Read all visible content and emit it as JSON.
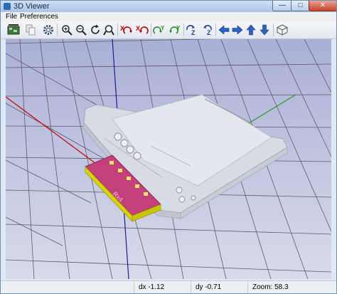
{
  "window": {
    "title": "3D Viewer"
  },
  "menu": {
    "items": [
      "File",
      "Preferences"
    ]
  },
  "toolbar": {
    "buttons": [
      {
        "name": "reload-board-icon"
      },
      {
        "name": "copy-image-icon"
      },
      {
        "name": "settings-icon"
      },
      {
        "name": "zoom-in-icon"
      },
      {
        "name": "zoom-out-icon"
      },
      {
        "name": "redraw-icon"
      },
      {
        "name": "zoom-fit-icon"
      },
      {
        "name": "rotate-x-cw-icon"
      },
      {
        "name": "rotate-x-ccw-icon"
      },
      {
        "name": "rotate-y-cw-icon"
      },
      {
        "name": "rotate-y-ccw-icon"
      },
      {
        "name": "rotate-z-cw-icon"
      },
      {
        "name": "rotate-z-ccw-icon"
      },
      {
        "name": "move-left-icon"
      },
      {
        "name": "move-right-icon"
      },
      {
        "name": "move-up-icon"
      },
      {
        "name": "move-down-icon"
      },
      {
        "name": "ortho-view-icon"
      }
    ]
  },
  "viewport": {
    "board_label": "Rx4"
  },
  "status": {
    "dx": "dx -1.12",
    "dy": "dy -0.71",
    "zoom": "Zoom: 58.3"
  },
  "colors": {
    "board_top": "#c4407a",
    "board_edge": "#d8d200",
    "grid_line": "#5a5c6e",
    "axis_red": "#cc0000",
    "axis_green": "#2b9a2b",
    "axis_blue": "#1c1c8c",
    "model_body": "#d7dbe3"
  }
}
